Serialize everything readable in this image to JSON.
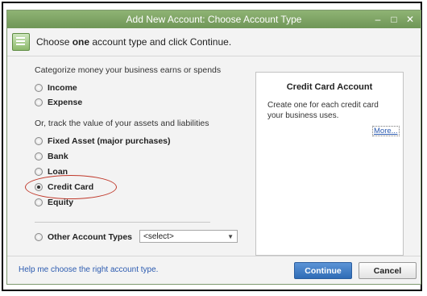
{
  "window": {
    "title": "Add New Account: Choose Account Type",
    "controls": [
      "–",
      "□",
      "✕"
    ]
  },
  "header": {
    "instruction_pre": "Choose ",
    "instruction_bold": "one",
    "instruction_post": " account type and click Continue."
  },
  "income_group": {
    "label": "Categorize money your business earns or spends",
    "options": [
      {
        "label": "Income",
        "checked": false
      },
      {
        "label": "Expense",
        "checked": false
      }
    ]
  },
  "asset_group": {
    "label": "Or, track the value of your assets and liabilities",
    "options": [
      {
        "label": "Fixed Asset (major purchases)",
        "checked": false
      },
      {
        "label": "Bank",
        "checked": false
      },
      {
        "label": "Loan",
        "checked": false
      },
      {
        "label": "Credit Card",
        "checked": true
      },
      {
        "label": "Equity",
        "checked": false
      }
    ]
  },
  "other_types": {
    "label": "Other Account Types",
    "select_value": "<select>"
  },
  "description": {
    "title": "Credit Card Account",
    "text": "Create one for each credit card your business uses.",
    "more_link": "More..."
  },
  "footer": {
    "help_link": "Help me choose the right account type.",
    "continue_label": "Continue",
    "cancel_label": "Cancel"
  },
  "colors": {
    "title_bar": "#7da664",
    "primary_button": "#3a78c2",
    "highlight_oval": "#c0392b",
    "link": "#2c5bb0"
  }
}
